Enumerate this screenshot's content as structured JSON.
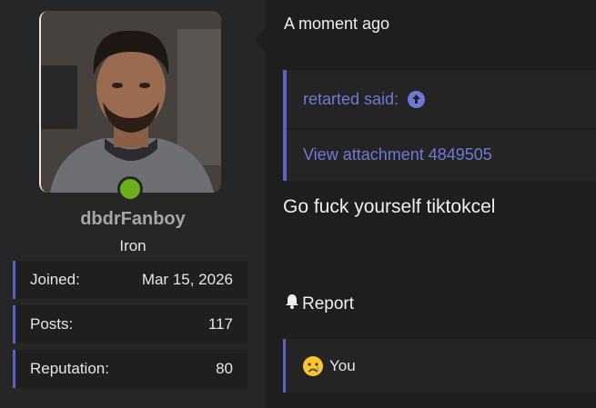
{
  "post": {
    "time": "A moment ago",
    "quote": {
      "author_line": "retarted said:",
      "body": "View attachment 4849505"
    },
    "message": "Go fuck yourself tiktokcel",
    "report_label": "Report",
    "reaction": {
      "emoji": "crying-face",
      "label": "You"
    }
  },
  "user": {
    "username": "dbdrFanboy",
    "rank": "Iron",
    "online": true,
    "stats": [
      {
        "label": "Joined:",
        "value": "Mar 15, 2026"
      },
      {
        "label": "Posts:",
        "value": "117"
      },
      {
        "label": "Reputation:",
        "value": "80"
      }
    ]
  },
  "colors": {
    "accent": "#5c63c7",
    "link": "#6f79d6",
    "online": "#6ab01d",
    "username": "#a6a6a6"
  }
}
